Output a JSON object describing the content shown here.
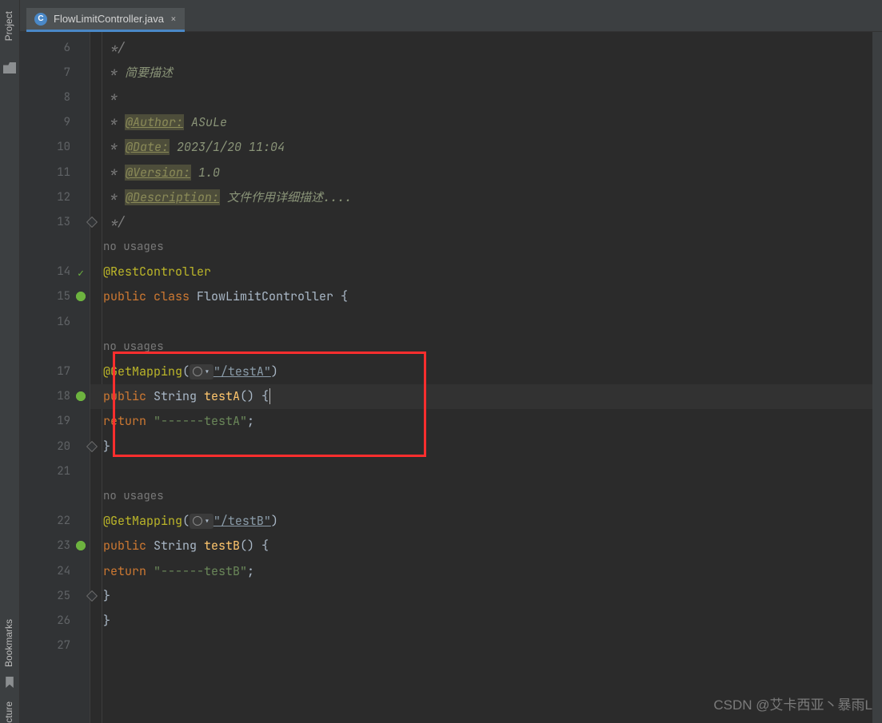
{
  "sidebar": {
    "project": "Project",
    "bookmarks": "Bookmarks",
    "ture": "cture"
  },
  "tab": {
    "label": "FlowLimitController.java",
    "icon": "C"
  },
  "lines": {
    "n6": "6",
    "n7": "7",
    "n8": "8",
    "n9": "9",
    "n10": "10",
    "n11": "11",
    "n12": "12",
    "n13": "13",
    "n14": "14",
    "n15": "15",
    "n16": "16",
    "n17": "17",
    "n18": "18",
    "n19": "19",
    "n20": "20",
    "n21": "21",
    "n22": "22",
    "n23": "23",
    "n24": "24",
    "n25": "25",
    "n26": "26",
    "n27": "27"
  },
  "code": {
    "l6": " */",
    "l7_pre": " * ",
    "l7_text": "简要描述",
    "l8": " *",
    "l9_pre": " * ",
    "l9_tag": "@Author:",
    "l9_val": " ASuLe",
    "l10_pre": " * ",
    "l10_tag": "@Date:",
    "l10_val": " 2023/1/20 11:04",
    "l11_pre": " * ",
    "l11_tag": "@Version:",
    "l11_val": " 1.0",
    "l12_pre": " * ",
    "l12_tag": "@Description:",
    "l12_val": " 文件作用详细描述....",
    "l13": " */",
    "usage": "no usages",
    "l14": "@RestController",
    "l15_kw1": "public ",
    "l15_kw2": "class ",
    "l15_name": "FlowLimitController ",
    "l15_b": "{",
    "l17_anno": "@GetMapping",
    "l17_p1": "(",
    "l17_link": "\"/testA\"",
    "l17_p2": ")",
    "l18_kw": "public ",
    "l18_type": "String ",
    "l18_m": "testA",
    "l18_rest": "() {",
    "l19_kw": "return ",
    "l19_str": "\"------testA\"",
    "l19_sc": ";",
    "l20": "}",
    "l22_anno": "@GetMapping",
    "l22_p1": "(",
    "l22_link": "\"/testB\"",
    "l22_p2": ")",
    "l23_kw": "public ",
    "l23_type": "String ",
    "l23_m": "testB",
    "l23_rest": "() {",
    "l24_kw": "return ",
    "l24_str": "\"------testB\"",
    "l24_sc": ";",
    "l25": "}",
    "l26": "}"
  },
  "watermark": "CSDN @艾卡西亚丶暴雨L"
}
